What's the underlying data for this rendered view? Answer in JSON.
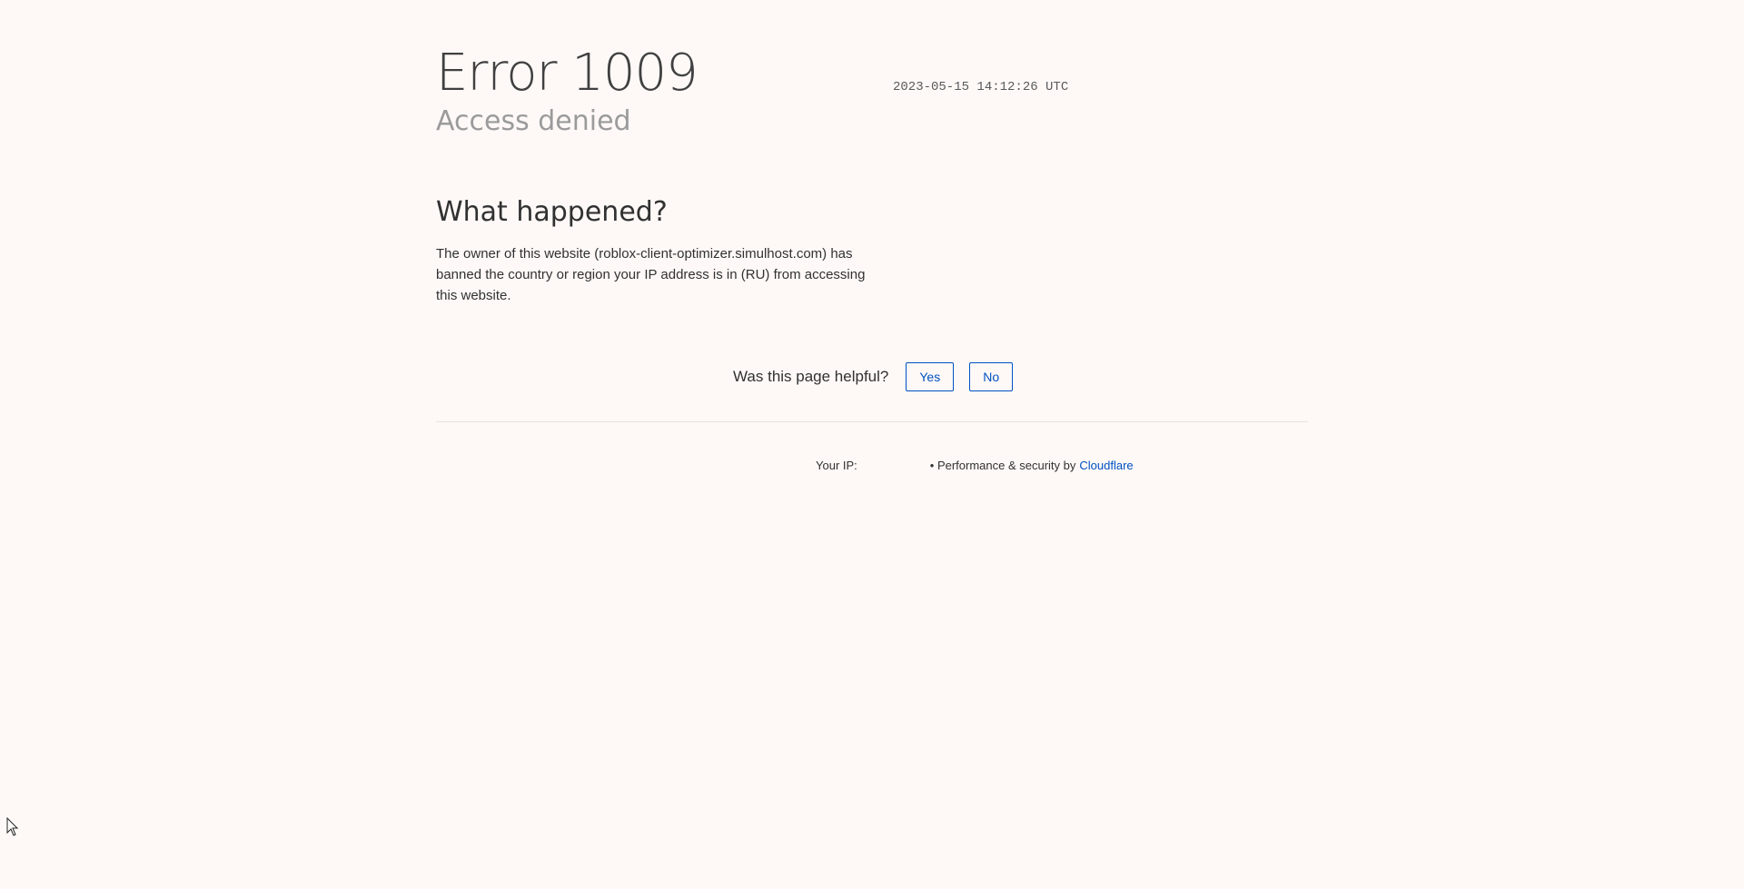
{
  "error": {
    "code_title": "Error 1009",
    "subtitle": "Access denied",
    "timestamp": "2023-05-15 14:12:26 UTC"
  },
  "what_happened": {
    "heading": "What happened?",
    "body": "The owner of this website (roblox-client-optimizer.simulhost.com) has banned the country or region your IP address is in (RU) from accessing this website."
  },
  "feedback": {
    "question": "Was this page helpful?",
    "yes_label": "Yes",
    "no_label": "No"
  },
  "footer": {
    "ip_label": "Your IP:",
    "ip_value": "",
    "performance_text": "• Performance & security by",
    "cloudflare_link": "Cloudflare"
  },
  "colors": {
    "background": "#fef9f7",
    "accent": "#0051c3"
  }
}
